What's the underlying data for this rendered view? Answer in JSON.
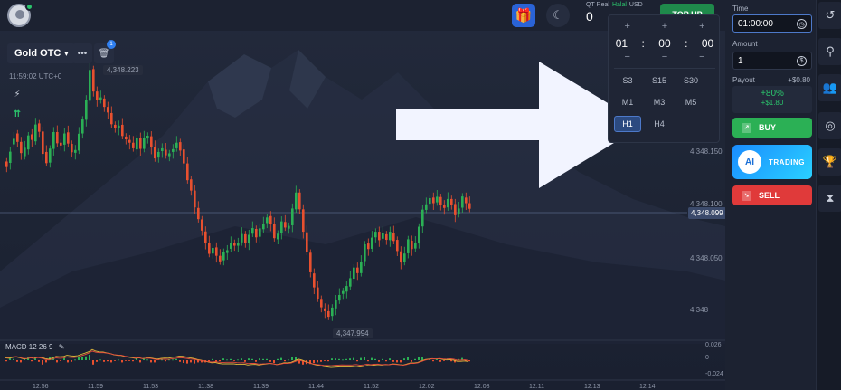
{
  "header": {
    "account_type": "QT Real",
    "halal": "Halal",
    "currency": "USD",
    "balance": "0",
    "topup_label": "TOP UP"
  },
  "chart_toolbar": {
    "asset": "Gold OTC",
    "server_time": "11:59:02 UTC+0",
    "badge_count": "1"
  },
  "chart": {
    "high_label": "4,348.223",
    "low_label": "4,347.994",
    "current_price": "4,348.099",
    "axis_ticks": [
      "4,348.150",
      "4,348.100",
      "4,348.050",
      "4,348"
    ],
    "macd_label": "MACD 12 26 9",
    "macd_ticks": [
      "0.026",
      "0",
      "-0.024"
    ],
    "time_ticks": [
      "12:56",
      "11:59",
      "11:53",
      "11:38",
      "11:39",
      "11:44",
      "11:52",
      "12:02",
      "12:08",
      "12:11",
      "12:13",
      "12:14"
    ],
    "colors": {
      "up": "#2bb055",
      "down": "#e8502f"
    }
  },
  "time_popup": {
    "plus": "+",
    "minus": "−",
    "hours": "01",
    "minutes": "00",
    "seconds": "00",
    "separator": ":",
    "timeframes": [
      "S3",
      "S15",
      "S30",
      "M1",
      "M3",
      "M5",
      "H1",
      "H4"
    ],
    "selected": "H1"
  },
  "panel": {
    "time_label": "Time",
    "time_value": "01:00:00",
    "amount_label": "Amount",
    "amount_value": "1",
    "payout_label": "Payout",
    "payout_value": "+$0.80",
    "payout_percent": "+80%",
    "payout_amount": "+$1.80",
    "buy_label": "BUY",
    "ai_logo": "AI",
    "ai_label": "TRADING",
    "sell_label": "SELL"
  },
  "rail_icons": [
    "history-icon",
    "signals-icon",
    "social-icon",
    "target-icon",
    "trophy-icon",
    "hourglass-icon"
  ],
  "candles": [
    [
      86.7,
      -2
    ],
    [
      86.2,
      4
    ],
    [
      92.8,
      2
    ],
    [
      96.7,
      -3
    ],
    [
      93.7,
      -4
    ],
    [
      88.6,
      3
    ],
    [
      91,
      5
    ],
    [
      96.4,
      -2
    ],
    [
      93.9,
      6
    ],
    [
      100.3,
      -3
    ],
    [
      97.4,
      -8
    ],
    [
      90.1,
      -4
    ],
    [
      86.3,
      5
    ],
    [
      91.2,
      6
    ],
    [
      97.2,
      -4
    ],
    [
      93.4,
      -1
    ],
    [
      92.7,
      4
    ],
    [
      97.1,
      -4
    ],
    [
      93,
      -3
    ],
    [
      89.8,
      1
    ],
    [
      90.6,
      6
    ],
    [
      96.7,
      5
    ],
    [
      101.6,
      7
    ],
    [
      108.4,
      11
    ],
    [
      119.7,
      -8
    ],
    [
      111.7,
      -3
    ],
    [
      108.6,
      1
    ],
    [
      109.2,
      -3
    ],
    [
      106.2,
      -2
    ],
    [
      104,
      -4
    ],
    [
      99.8,
      -1
    ],
    [
      98.5,
      1
    ],
    [
      99.8,
      -4
    ],
    [
      95.6,
      -1
    ],
    [
      94.4,
      -1
    ],
    [
      93.4,
      -2
    ],
    [
      91,
      4
    ],
    [
      95.2,
      -4
    ],
    [
      91.2,
      4
    ],
    [
      94.9,
      1
    ],
    [
      95.7,
      -4
    ],
    [
      91.8,
      -4
    ],
    [
      88.1,
      2
    ],
    [
      90.4,
      1
    ],
    [
      90.9,
      -2
    ],
    [
      88.6,
      1
    ],
    [
      90.1,
      1
    ],
    [
      91.4,
      2
    ],
    [
      93.6,
      -3
    ],
    [
      91,
      -5
    ],
    [
      86,
      -6
    ],
    [
      80.3,
      -4
    ],
    [
      76.3,
      -6
    ],
    [
      70.1,
      -4
    ],
    [
      66,
      -4
    ],
    [
      61.7,
      -4
    ],
    [
      57.7,
      -4
    ],
    [
      53.8,
      2
    ],
    [
      56,
      -3
    ],
    [
      53,
      -2
    ],
    [
      51.4,
      3
    ],
    [
      54,
      1
    ],
    [
      55.5,
      2
    ],
    [
      57.6,
      -1
    ],
    [
      56.6,
      1
    ],
    [
      57.8,
      3
    ],
    [
      60.7,
      -3
    ],
    [
      57.5,
      3
    ],
    [
      60.9,
      2
    ],
    [
      62.6,
      -3
    ],
    [
      59.8,
      3
    ],
    [
      62.5,
      2
    ],
    [
      64.7,
      2
    ],
    [
      67.2,
      -3
    ],
    [
      64.3,
      -5
    ],
    [
      58.9,
      2
    ],
    [
      61.3,
      4
    ],
    [
      65.1,
      -2
    ],
    [
      62.7,
      1
    ],
    [
      63.9,
      6
    ],
    [
      69.6,
      6
    ],
    [
      75.6,
      -6
    ],
    [
      69.6,
      -8
    ],
    [
      61.4,
      -7
    ],
    [
      54.1,
      -7
    ],
    [
      46.7,
      -5
    ],
    [
      41.7,
      -4
    ],
    [
      37.6,
      -3
    ],
    [
      34.2,
      -1
    ],
    [
      33.2,
      -2
    ],
    [
      31.5,
      3
    ],
    [
      34.2,
      3
    ],
    [
      37,
      2
    ],
    [
      39.4,
      1
    ],
    [
      40.2,
      2
    ],
    [
      42,
      3
    ],
    [
      44.8,
      4
    ],
    [
      48.8,
      -2
    ],
    [
      46.8,
      4
    ],
    [
      51.1,
      6
    ],
    [
      57.4,
      -2
    ],
    [
      55.5,
      4
    ],
    [
      59.6,
      2
    ],
    [
      61.6,
      -3
    ],
    [
      59.1,
      2
    ],
    [
      60.7,
      -2
    ],
    [
      58.6,
      3
    ],
    [
      61.3,
      -3
    ],
    [
      58.7,
      -4
    ],
    [
      54.6,
      -4
    ],
    [
      50.8,
      3
    ],
    [
      53.9,
      5
    ],
    [
      58.4,
      -3
    ],
    [
      55.6,
      2
    ],
    [
      57.4,
      6
    ],
    [
      63.5,
      6
    ],
    [
      69.4,
      2
    ],
    [
      71.6,
      2
    ],
    [
      73.8,
      -2
    ],
    [
      72.1,
      2
    ],
    [
      74,
      -3
    ],
    [
      71.1,
      -1
    ],
    [
      70.3,
      3
    ],
    [
      73.3,
      -2
    ],
    [
      71.5,
      -4
    ],
    [
      67.9,
      2
    ],
    [
      70.2,
      4
    ],
    [
      73.8,
      -2
    ],
    [
      71.8,
      -2
    ]
  ]
}
